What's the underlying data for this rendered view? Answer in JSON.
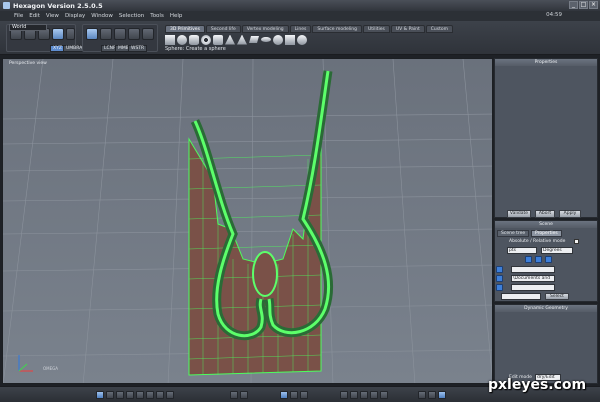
{
  "window": {
    "title": "Hexagon Version 2.5.0.5",
    "clock": "04:59"
  },
  "menu": [
    "File",
    "Edit",
    "View",
    "Display",
    "Window",
    "Selection",
    "Tools",
    "Help"
  ],
  "toolbar": {
    "coord_system": "World",
    "snap_buttons": [
      "XYZ",
      "UMBRA"
    ],
    "view_buttons": [
      "LCNP",
      "MMB",
      "WSTR"
    ],
    "tabs": [
      {
        "label": "3D Primitives",
        "active": true
      },
      {
        "label": "Second life",
        "active": false
      },
      {
        "label": "Vertex modeling",
        "active": false
      },
      {
        "label": "Lines",
        "active": false
      },
      {
        "label": "Surface modeling",
        "active": false
      },
      {
        "label": "Utilities",
        "active": false
      },
      {
        "label": "UV & Paint",
        "active": false
      },
      {
        "label": "Custom",
        "active": false
      }
    ],
    "status_hint": "Sphere: Create a sphere"
  },
  "viewport": {
    "label": "Perspective view",
    "axis_label": "OMEGA"
  },
  "properties": {
    "header": "Properties",
    "buttons": [
      "Validate",
      "Abort",
      "Apply"
    ]
  },
  "scene": {
    "header": "Scene",
    "tabs": [
      {
        "label": "Scene tree",
        "active": false
      },
      {
        "label": "Properties",
        "active": true
      }
    ],
    "mode_label": "Absolute / Relative mode",
    "unit_value": "pts",
    "angle_value": "Degrees",
    "path_value": "\\Documents and",
    "select_button": "Select"
  },
  "dynamic": {
    "header": "Dynamic Geometry",
    "edit_mode_label": "Edit mode",
    "edit_mode_value": "dry/Edit"
  },
  "watermark": "pxleyes.com",
  "colors": {
    "accent": "#5e8ccf",
    "mesh_fill": "#7a5148",
    "mesh_edge": "#4cff5c",
    "viewport_bg": "#6f7783"
  }
}
